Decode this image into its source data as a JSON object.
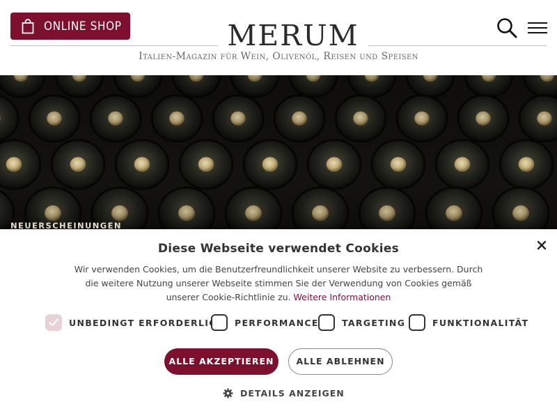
{
  "header": {
    "shop_button_label": "ONLINE SHOP",
    "logo_text": "MERUM",
    "tagline": "Italien-Magazin für Wein, Olivenöl, Reisen und Speisen",
    "shop_icon": "shopping-bag-icon",
    "search_icon": "search-icon",
    "menu_icon": "hamburger-menu-icon"
  },
  "hero": {
    "label": "NEUERSCHEINUNGEN"
  },
  "cookie_banner": {
    "title": "Diese Webseite verwendet Cookies",
    "text": "Wir verwenden Cookies, um die Benutzerfreundlichkeit unserer Website zu verbessern. Durch die weitere Nutzung unserer Webseite stimmen Sie der Verwendung von Cookies gemäß unserer Cookie-Richtlinie zu.",
    "link_text": "Weitere Informationen",
    "options": [
      {
        "label": "UNBEDINGT ERFORDERLICH",
        "checked": true
      },
      {
        "label": "PERFORMANCE",
        "checked": false
      },
      {
        "label": "TARGETING",
        "checked": false
      },
      {
        "label": "FUNKTIONALITÄT",
        "checked": false
      }
    ],
    "accept_label": "ALLE AKZEPTIEREN",
    "reject_label": "ALLE ABLEHNEN",
    "details_label": "DETAILS ANZEIGEN",
    "close_icon": "close-icon",
    "details_icon": "gear-icon"
  },
  "colors": {
    "brand": "#7d0f2f",
    "checked_box": "#e9d2d7"
  }
}
